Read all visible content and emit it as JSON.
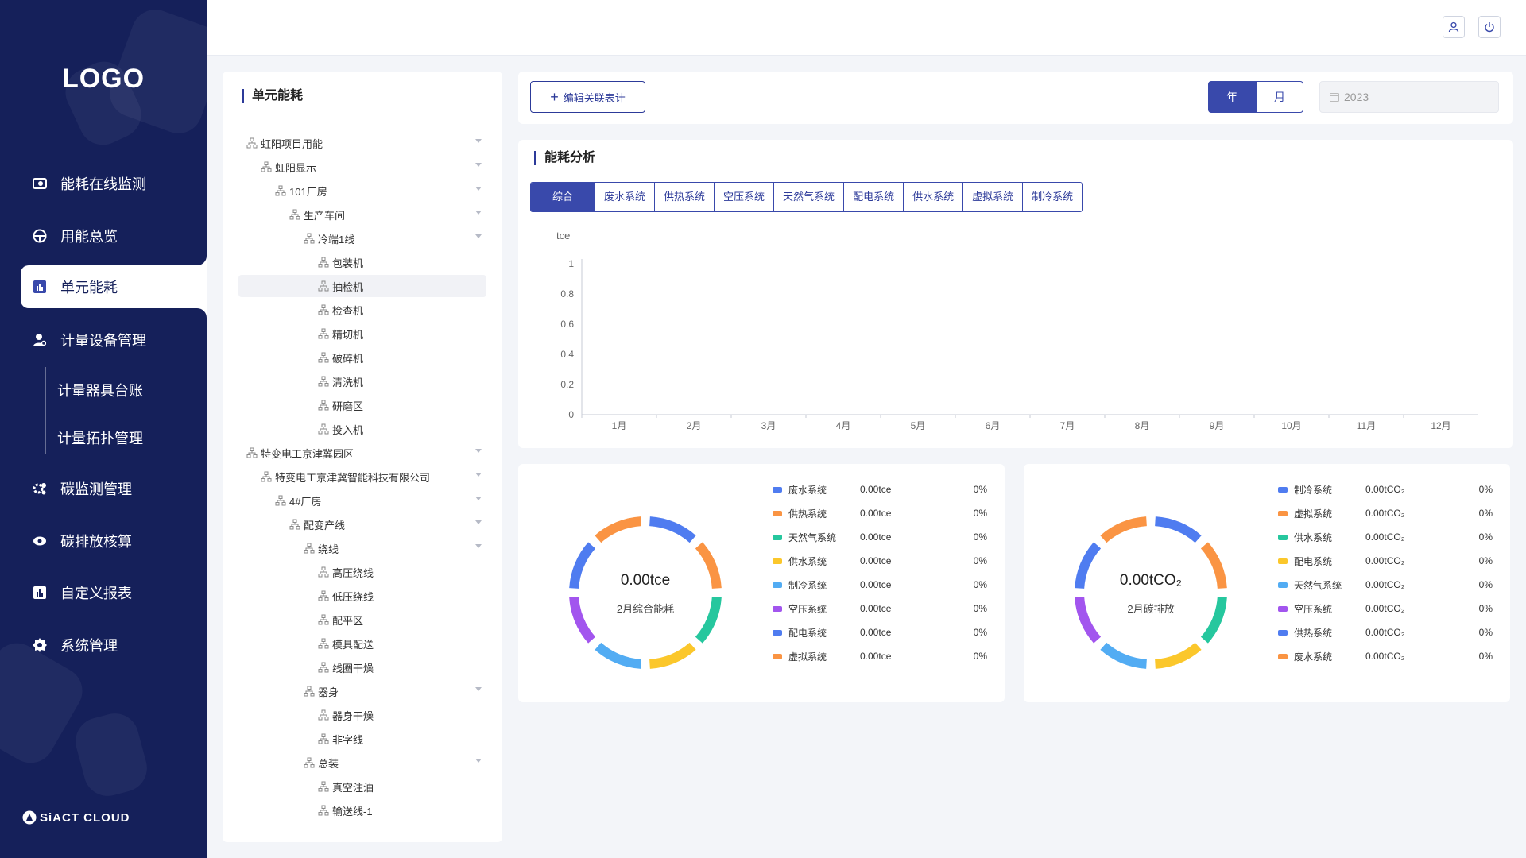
{
  "sidebar": {
    "logo": "LOGO",
    "brand": "SiACT CLOUD",
    "items": [
      {
        "label": "能耗在线监测",
        "icon": "monitor-icon"
      },
      {
        "label": "用能总览",
        "icon": "dashboard-icon"
      },
      {
        "label": "单元能耗",
        "icon": "bar-chart-icon"
      },
      {
        "label": "计量设备管理",
        "icon": "user-device-icon"
      },
      {
        "label": "碳监测管理",
        "icon": "gear-cluster-icon"
      },
      {
        "label": "碳排放核算",
        "icon": "eye-cloud-icon"
      },
      {
        "label": "自定义报表",
        "icon": "report-icon"
      },
      {
        "label": "系统管理",
        "icon": "settings-icon"
      }
    ],
    "subitems": [
      {
        "label": "计量器具台账"
      },
      {
        "label": "计量拓扑管理"
      }
    ]
  },
  "header": {
    "user_icon": "user-icon",
    "power_icon": "power-icon"
  },
  "tree": {
    "title": "单元能耗",
    "nodes": [
      {
        "label": "虹阳项目用能",
        "level": 0,
        "expandable": true
      },
      {
        "label": "虹阳显示",
        "level": 1,
        "expandable": true
      },
      {
        "label": "101厂房",
        "level": 2,
        "expandable": true
      },
      {
        "label": "生产车间",
        "level": 3,
        "expandable": true
      },
      {
        "label": "冷端1线",
        "level": 4,
        "expandable": true
      },
      {
        "label": "包装机",
        "level": 5,
        "expandable": false
      },
      {
        "label": "抽检机",
        "level": 5,
        "expandable": false,
        "selected": true
      },
      {
        "label": "检查机",
        "level": 5,
        "expandable": false
      },
      {
        "label": "精切机",
        "level": 5,
        "expandable": false
      },
      {
        "label": "破碎机",
        "level": 5,
        "expandable": false
      },
      {
        "label": "清洗机",
        "level": 5,
        "expandable": false
      },
      {
        "label": "研磨区",
        "level": 5,
        "expandable": false
      },
      {
        "label": "投入机",
        "level": 5,
        "expandable": false
      },
      {
        "label": "特变电工京津冀园区",
        "level": 0,
        "expandable": true
      },
      {
        "label": "特变电工京津冀智能科技有限公司",
        "level": 1,
        "expandable": true
      },
      {
        "label": "4#厂房",
        "level": 2,
        "expandable": true
      },
      {
        "label": "配变产线",
        "level": 3,
        "expandable": true
      },
      {
        "label": "绕线",
        "level": 4,
        "expandable": true
      },
      {
        "label": "高压绕线",
        "level": 5,
        "expandable": false
      },
      {
        "label": "低压绕线",
        "level": 5,
        "expandable": false
      },
      {
        "label": "配平区",
        "level": 5,
        "expandable": false
      },
      {
        "label": "模具配送",
        "level": 5,
        "expandable": false
      },
      {
        "label": "线圈干燥",
        "level": 5,
        "expandable": false
      },
      {
        "label": "器身",
        "level": 4,
        "expandable": true
      },
      {
        "label": "器身干燥",
        "level": 5,
        "expandable": false
      },
      {
        "label": "非字线",
        "level": 5,
        "expandable": false
      },
      {
        "label": "总装",
        "level": 4,
        "expandable": true
      },
      {
        "label": "真空注油",
        "level": 5,
        "expandable": false
      },
      {
        "label": "输送线-1",
        "level": 5,
        "expandable": false
      }
    ]
  },
  "toolbar": {
    "edit_label": "编辑关联表计",
    "year_label": "年",
    "month_label": "月",
    "year_value": "2023",
    "mode": "年"
  },
  "analysis": {
    "title": "能耗分析",
    "tabs": [
      "综合",
      "废水系统",
      "供热系统",
      "空压系统",
      "天然气系统",
      "配电系统",
      "供水系统",
      "虚拟系统",
      "制冷系统"
    ],
    "active_tab": "综合"
  },
  "chart_data": [
    {
      "type": "line",
      "ylabel": "tce",
      "ylim": [
        0,
        1
      ],
      "yticks": [
        "0",
        "0.2",
        "0.4",
        "0.6",
        "0.8",
        "1"
      ],
      "categories": [
        "1月",
        "2月",
        "3月",
        "4月",
        "5月",
        "6月",
        "7月",
        "8月",
        "9月",
        "10月",
        "11月",
        "12月"
      ],
      "series": [],
      "grid": false
    },
    {
      "type": "pie",
      "center_value": "0.00tce",
      "center_label": "2月综合能耗",
      "legend": [
        {
          "name": "废水系统",
          "value": "0.00tce",
          "percent": "0%",
          "color": "#4f7cf0"
        },
        {
          "name": "供热系统",
          "value": "0.00tce",
          "percent": "0%",
          "color": "#fa9443"
        },
        {
          "name": "天然气系统",
          "value": "0.00tce",
          "percent": "0%",
          "color": "#26c79e"
        },
        {
          "name": "供水系统",
          "value": "0.00tce",
          "percent": "0%",
          "color": "#fbc72b"
        },
        {
          "name": "制冷系统",
          "value": "0.00tce",
          "percent": "0%",
          "color": "#52acf3"
        },
        {
          "name": "空压系统",
          "value": "0.00tce",
          "percent": "0%",
          "color": "#a255ee"
        },
        {
          "name": "配电系统",
          "value": "0.00tce",
          "percent": "0%",
          "color": "#4f7cf0"
        },
        {
          "name": "虚拟系统",
          "value": "0.00tce",
          "percent": "0%",
          "color": "#fa9443"
        }
      ]
    },
    {
      "type": "pie",
      "center_value": "0.00tCO₂",
      "center_label": "2月碳排放",
      "legend": [
        {
          "name": "制冷系统",
          "value": "0.00tCO₂",
          "percent": "0%",
          "color": "#4f7cf0"
        },
        {
          "name": "虚拟系统",
          "value": "0.00tCO₂",
          "percent": "0%",
          "color": "#fa9443"
        },
        {
          "name": "供水系统",
          "value": "0.00tCO₂",
          "percent": "0%",
          "color": "#26c79e"
        },
        {
          "name": "配电系统",
          "value": "0.00tCO₂",
          "percent": "0%",
          "color": "#fbc72b"
        },
        {
          "name": "天然气系统",
          "value": "0.00tCO₂",
          "percent": "0%",
          "color": "#52acf3"
        },
        {
          "name": "空压系统",
          "value": "0.00tCO₂",
          "percent": "0%",
          "color": "#a255ee"
        },
        {
          "name": "供热系统",
          "value": "0.00tCO₂",
          "percent": "0%",
          "color": "#4f7cf0"
        },
        {
          "name": "废水系统",
          "value": "0.00tCO₂",
          "percent": "0%",
          "color": "#fa9443"
        }
      ]
    }
  ],
  "colors": {
    "sidebar_bg": "#15205a",
    "accent": "#3949ab"
  }
}
